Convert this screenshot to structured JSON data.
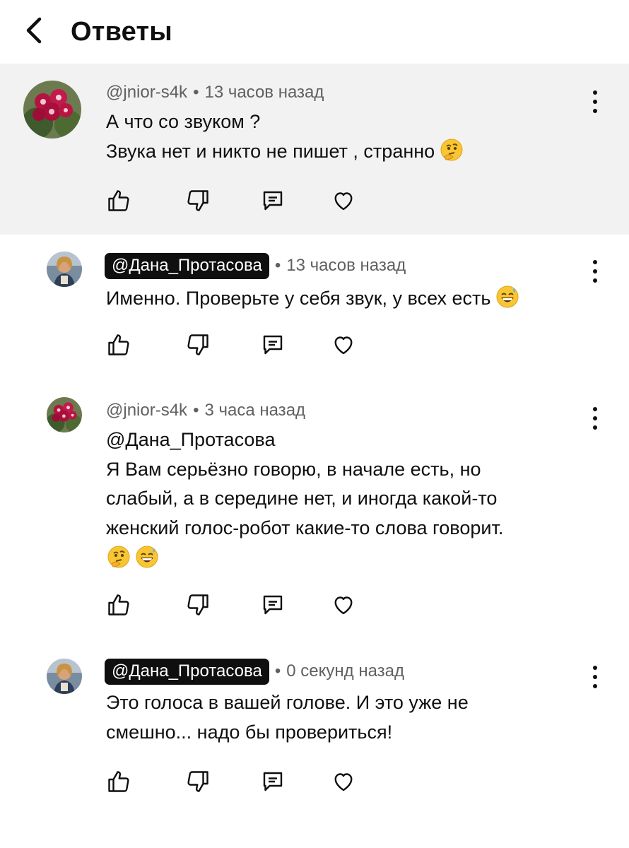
{
  "header": {
    "title": "Ответы",
    "back_icon": "chevron-left-icon"
  },
  "comments": [
    {
      "author": "@jnior-s4k",
      "time": "13 часов назад",
      "lines": [
        "А что со звуком ?",
        "Звука нет и никто не пишет , странно"
      ],
      "trailing_emoji": "thinking-face-emoji",
      "avatar": "violet-flower-avatar",
      "author_style": "plain",
      "highlighted": true
    },
    {
      "author": "@Дана_Протасова",
      "time": "13 часов назад",
      "lines": [
        "Именно. Проверьте у себя звук, у всех есть"
      ],
      "trailing_emoji": "grinning-sweat-emoji",
      "avatar": "woman-photo-avatar",
      "author_style": "chip",
      "highlighted": false
    },
    {
      "author": "@jnior-s4k",
      "time": "3 часа назад",
      "lines": [
        "@Дана_Протасова",
        "Я Вам серьёзно говорю, в начале есть, но",
        "слабый, а в середине нет, и иногда какой-то",
        "женский голос-робот какие-то слова говорит."
      ],
      "emoji_line": [
        "thinking-face-emoji",
        "grinning-sweat-emoji"
      ],
      "avatar": "violet-flower-avatar",
      "author_style": "plain",
      "highlighted": false
    },
    {
      "author": "@Дана_Протасова",
      "time": "0 секунд назад",
      "lines": [
        "Это голоса в вашей голове. И это уже не",
        "смешно... надо бы провериться!"
      ],
      "avatar": "woman-photo-avatar",
      "author_style": "chip",
      "highlighted": false
    }
  ],
  "icons": {
    "like": "thumbs-up-icon",
    "dislike": "thumbs-down-icon",
    "reply": "reply-comment-icon",
    "heart": "heart-icon",
    "menu": "more-vertical-icon"
  },
  "colors": {
    "background": "#ffffff",
    "highlight": "#f2f2f2",
    "text": "#0f0f0f",
    "meta": "#606060",
    "chip": "#0f0f0f"
  }
}
